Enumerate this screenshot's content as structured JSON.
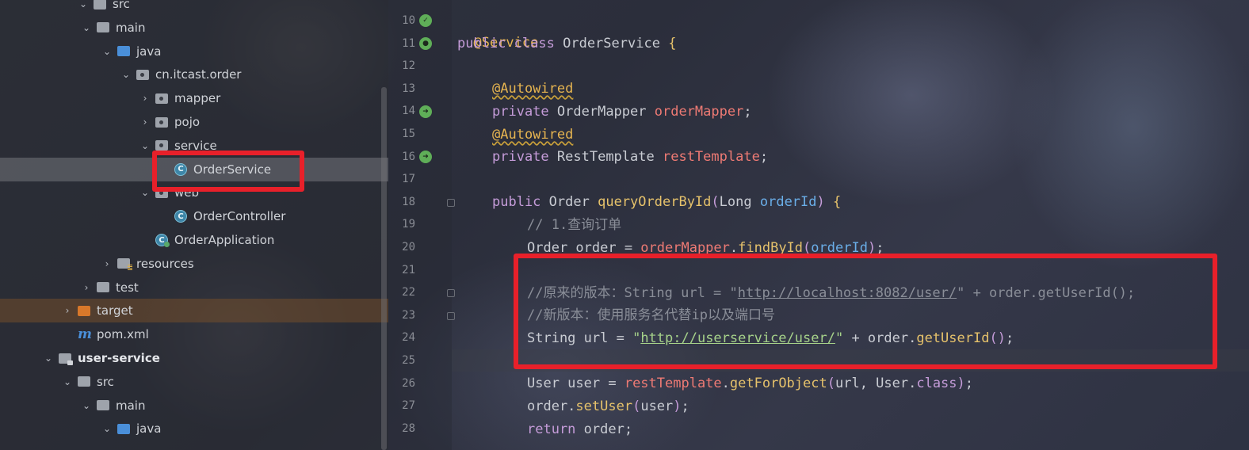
{
  "project_tree": [
    {
      "label": "src",
      "indent": 98,
      "chev": "v",
      "icon": "folder"
    },
    {
      "label": "main",
      "indent": 102,
      "chev": "v",
      "icon": "folder"
    },
    {
      "label": "java",
      "indent": 128,
      "chev": "v",
      "icon": "folder-blue"
    },
    {
      "label": "cn.itcast.order",
      "indent": 152,
      "chev": "v",
      "icon": "package"
    },
    {
      "label": "mapper",
      "indent": 176,
      "chev": ">",
      "icon": "package"
    },
    {
      "label": "pojo",
      "indent": 176,
      "chev": ">",
      "icon": "package"
    },
    {
      "label": "service",
      "indent": 176,
      "chev": "v",
      "icon": "package"
    },
    {
      "label": "OrderService",
      "indent": 200,
      "chev": "",
      "icon": "class",
      "selected": true
    },
    {
      "label": "web",
      "indent": 176,
      "chev": "v",
      "icon": "package"
    },
    {
      "label": "OrderController",
      "indent": 200,
      "chev": "",
      "icon": "class"
    },
    {
      "label": "OrderApplication",
      "indent": 176,
      "chev": "",
      "icon": "app"
    },
    {
      "label": "resources",
      "indent": 128,
      "chev": ">",
      "icon": "resources"
    },
    {
      "label": "test",
      "indent": 102,
      "chev": ">",
      "icon": "folder"
    },
    {
      "label": "target",
      "indent": 78,
      "chev": ">",
      "icon": "folder-orange",
      "excluded": true
    },
    {
      "label": "pom.xml",
      "indent": 78,
      "chev": "",
      "icon": "maven"
    },
    {
      "label": "user-service",
      "indent": 54,
      "chev": "v",
      "icon": "module",
      "bold": true
    },
    {
      "label": "src",
      "indent": 78,
      "chev": "v",
      "icon": "folder"
    },
    {
      "label": "main",
      "indent": 102,
      "chev": "v",
      "icon": "folder"
    },
    {
      "label": "java",
      "indent": 128,
      "chev": "v",
      "icon": "folder-blue"
    }
  ],
  "editor": {
    "line_numbers": [
      "10",
      "11",
      "12",
      "13",
      "14",
      "15",
      "16",
      "17",
      "18",
      "19",
      "20",
      "21",
      "22",
      "23",
      "24",
      "25",
      "26",
      "27",
      "28"
    ],
    "lines": {
      "l10": {
        "ann": "@Service"
      },
      "l11": {
        "kw1": "public",
        "kw2": "class",
        "name": "OrderService",
        "brace": "{"
      },
      "l13": {
        "ann": "@Autowired"
      },
      "l14": {
        "kw": "private",
        "type": "OrderMapper",
        "field": "orderMapper",
        "end": ";"
      },
      "l15": {
        "ann": "@Autowired"
      },
      "l16": {
        "kw": "private",
        "type": "RestTemplate",
        "field": "restTemplate",
        "end": ";"
      },
      "l18": {
        "kw": "public",
        "type": "Order",
        "method": "queryOrderById",
        "p1": "(",
        "ptype": "Long",
        "param": "orderId",
        "p2": ")",
        "brace": "{"
      },
      "l19": {
        "comment": "// 1.查询订单"
      },
      "l20": {
        "pre": "Order order = ",
        "field": "orderMapper",
        "dot": ".",
        "method": "findById",
        "p1": "(",
        "param": "orderId",
        "p2": ")",
        "end": ";"
      },
      "l22": {
        "comment": "//原来的版本：String url = \"",
        "link": "http://localhost:8082/user/",
        "rest": "\" + order.getUserId();"
      },
      "l23": {
        "comment": "//新版本：使用服务名代替ip以及端口号"
      },
      "l24": {
        "pre": "String url = ",
        "q1": "\"",
        "link": "http://userservice/user/",
        "q2": "\"",
        "mid": " + order.",
        "method": "getUserId",
        "paren": "()",
        "end": ";"
      },
      "l26": {
        "pre": "User user = ",
        "field": "restTemplate",
        "dot": ".",
        "method": "getForObject",
        "p1": "(",
        "args": "url, User.",
        "kw": "class",
        "p2": ")",
        "end": ";"
      },
      "l27": {
        "pre": "order.",
        "method": "setUser",
        "p1": "(",
        "args": "user",
        "p2": ")",
        "end": ";"
      },
      "l28": {
        "kw": "return",
        "rest": " order;"
      }
    }
  },
  "highlight_color": "#e8202a"
}
